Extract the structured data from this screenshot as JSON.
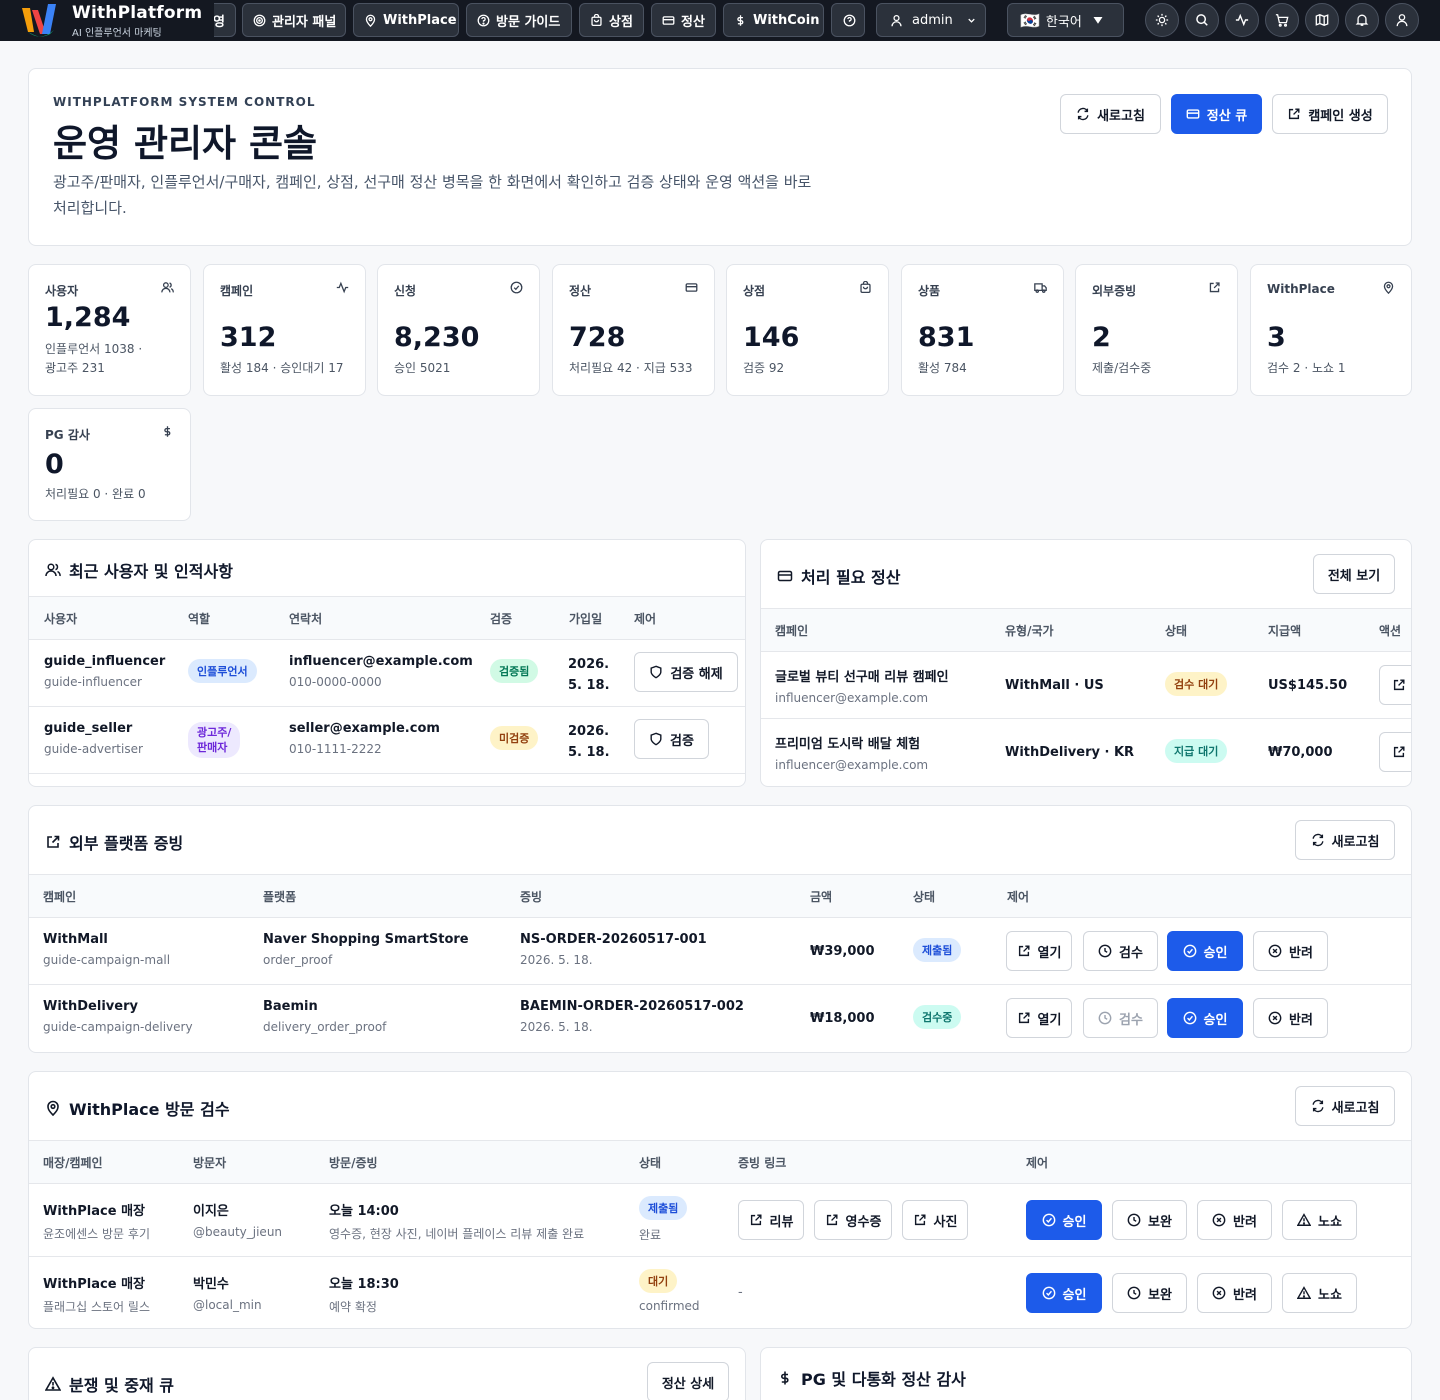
{
  "app": {
    "title": "WithPlatform",
    "subtitle": "AI 인플루언서 마케팅",
    "brand_colors": [
      "#f59e0b",
      "#ef4444",
      "#3b82f6",
      "#10b981"
    ]
  },
  "nav": {
    "partial_tab": "영",
    "tabs": [
      "관리자 패널",
      "WithPlace",
      "방문 가이드",
      "상점",
      "정산",
      "WithCoin"
    ],
    "user": "admin",
    "language": "한국어",
    "language_flag": "🇰🇷"
  },
  "header": {
    "eyebrow": "WITHPLATFORM SYSTEM CONTROL",
    "title": "운영 관리자 콘솔",
    "description": "광고주/판매자, 인플루언서/구매자, 캠페인, 상점, 선구매 정산 병목을 한 화면에서 확인하고 검증 상태와 운영 액션을 바로 처리합니다.",
    "refresh_label": "새로고침",
    "settlement_queue_label": "정산 큐",
    "create_campaign_label": "캠페인 생성"
  },
  "stats": [
    {
      "label": "사용자",
      "value": "1,284",
      "sub": "인플루언서 1038 · 광고주 231",
      "icon": "users-icon"
    },
    {
      "label": "캠페인",
      "value": "312",
      "sub": "활성 184 · 승인대기 17",
      "icon": "activity-icon"
    },
    {
      "label": "신청",
      "value": "8,230",
      "sub": "승인 5021",
      "icon": "check-circle-icon"
    },
    {
      "label": "정산",
      "value": "728",
      "sub": "처리필요 42 · 지급 533",
      "icon": "card-icon"
    },
    {
      "label": "상점",
      "value": "146",
      "sub": "검증 92",
      "icon": "bag-icon"
    },
    {
      "label": "상품",
      "value": "831",
      "sub": "활성 784",
      "icon": "truck-icon"
    },
    {
      "label": "외부증빙",
      "value": "2",
      "sub": "제출/검수중",
      "icon": "external-link-icon"
    },
    {
      "label": "WithPlace",
      "value": "3",
      "sub": "검수 2 · 노쇼 1",
      "icon": "map-pin-icon"
    },
    {
      "label": "PG 감사",
      "value": "0",
      "sub": "처리필요 0 · 완료 0",
      "icon": "dollar-icon"
    }
  ],
  "users_section": {
    "title": "최근 사용자 및 인적사항",
    "columns": [
      "사용자",
      "역할",
      "연락처",
      "검증",
      "가입일",
      "제어"
    ],
    "rows": [
      {
        "name": "guide_influencer",
        "handle": "guide-influencer",
        "role": "인플루언서",
        "email": "influencer@example.com",
        "phone": "010-0000-0000",
        "status": "검증됨",
        "date": "2026.\n5. 18.",
        "action": "검증 해제"
      },
      {
        "name": "guide_seller",
        "handle": "guide-advertiser",
        "role": "광고주/\n판매자",
        "email": "seller@example.com",
        "phone": "010-1111-2222",
        "status": "미검증",
        "date": "2026.\n5. 18.",
        "action": "검증"
      }
    ]
  },
  "settlement_section": {
    "title": "처리 필요 정산",
    "view_all_label": "전체 보기",
    "columns": [
      "캠페인",
      "유형/국가",
      "상태",
      "지급액",
      "액션"
    ],
    "rows": [
      {
        "campaign": "글로벌 뷰티 선구매 리뷰 캠페인",
        "email": "influencer@example.com",
        "type": "WithMall · US",
        "status": "검수 대기",
        "amount": "US$145.50"
      },
      {
        "campaign": "프리미엄 도시락 배달 체험",
        "email": "influencer@example.com",
        "type": "WithDelivery · KR",
        "status": "지급 대기",
        "amount": "₩70,000"
      }
    ]
  },
  "proof_section": {
    "title": "외부 플랫폼 증빙",
    "refresh_label": "새로고침",
    "columns": [
      "캠페인",
      "플랫폼",
      "증빙",
      "금액",
      "상태",
      "제어"
    ],
    "actions": {
      "open": "열기",
      "review": "검수",
      "approve": "승인",
      "reject": "반려"
    },
    "rows": [
      {
        "campaign": "WithMall",
        "slug": "guide-campaign-mall",
        "platform": "Naver Shopping SmartStore",
        "proof_type": "order_proof",
        "order": "NS-ORDER-20260517-001",
        "date": "2026. 5. 18.",
        "amount": "₩39,000",
        "status": "제출됨"
      },
      {
        "campaign": "WithDelivery",
        "slug": "guide-campaign-delivery",
        "platform": "Baemin",
        "proof_type": "delivery_order_proof",
        "order": "BAEMIN-ORDER-20260517-002",
        "date": "2026. 5. 18.",
        "amount": "₩18,000",
        "status": "검수중"
      }
    ]
  },
  "visit_section": {
    "title": "WithPlace 방문 검수",
    "refresh_label": "새로고침",
    "columns": [
      "매장/캠페인",
      "방문자",
      "방문/증빙",
      "상태",
      "증빙 링크",
      "제어"
    ],
    "links": {
      "review": "리뷰",
      "receipt": "영수증",
      "photo": "사진"
    },
    "actions": {
      "approve": "승인",
      "hold": "보완",
      "reject": "반려",
      "noshow": "노쇼"
    },
    "rows": [
      {
        "store": "WithPlace 매장",
        "campaign": "윤조에센스 방문 후기",
        "visitor": "이지은",
        "handle": "@beauty_jieun",
        "time": "오늘 14:00",
        "note": "영수증, 현장 사진, 네이버 플레이스 리뷰 제출 완료",
        "status": "제출됨",
        "status_sub": "완료",
        "links_empty": ""
      },
      {
        "store": "WithPlace 매장",
        "campaign": "플래그십 스토어 릴스",
        "visitor": "박민수",
        "handle": "@local_min",
        "time": "오늘 18:30",
        "note": "예약 확정",
        "status": "대기",
        "status_sub": "confirmed",
        "links_empty": "-"
      }
    ]
  },
  "dispute_section": {
    "title": "분쟁 및 중재 큐",
    "detail_label": "정산 상세"
  },
  "pg_section": {
    "title": "PG 및 다통화 정산 감사"
  }
}
